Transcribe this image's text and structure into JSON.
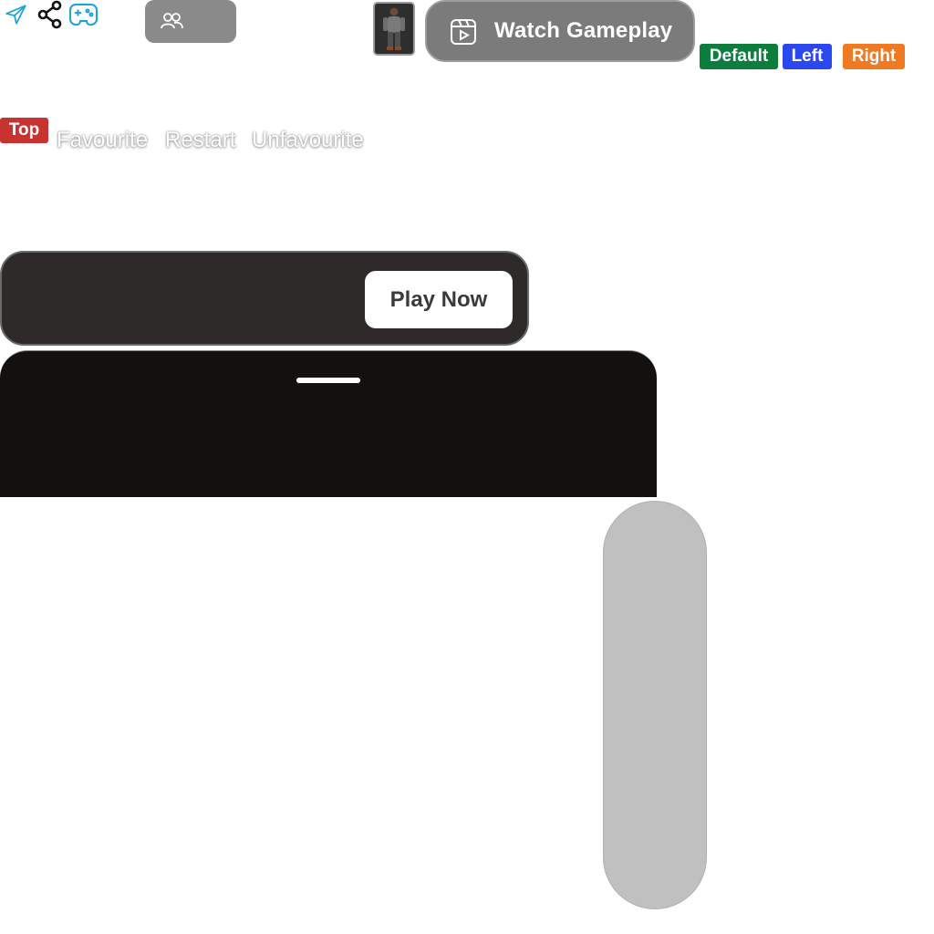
{
  "icons": {
    "send": "send-icon",
    "share": "share-icon",
    "gamepad": "gamepad-icon",
    "people": "people-icon",
    "watch": "video-play-icon"
  },
  "colors": {
    "send_icon": "#1aa3d9",
    "gamepad_icon": "#1aa3d9",
    "default_tag": "#0d7d3e",
    "left_tag": "#2b47ee",
    "right_tag": "#ef7a22",
    "top_tag": "#c8322f",
    "play_bar": "#2e2a29",
    "sheet": "#12110f"
  },
  "header": {
    "watch_label": "Watch Gameplay"
  },
  "position_tags": {
    "default": "Default",
    "left": "Left",
    "right": "Right",
    "top": "Top"
  },
  "actions": {
    "favourite": "Favourite",
    "restart": "Restart",
    "unfavourite": "Unfavourite"
  },
  "play": {
    "label": "Play Now"
  }
}
